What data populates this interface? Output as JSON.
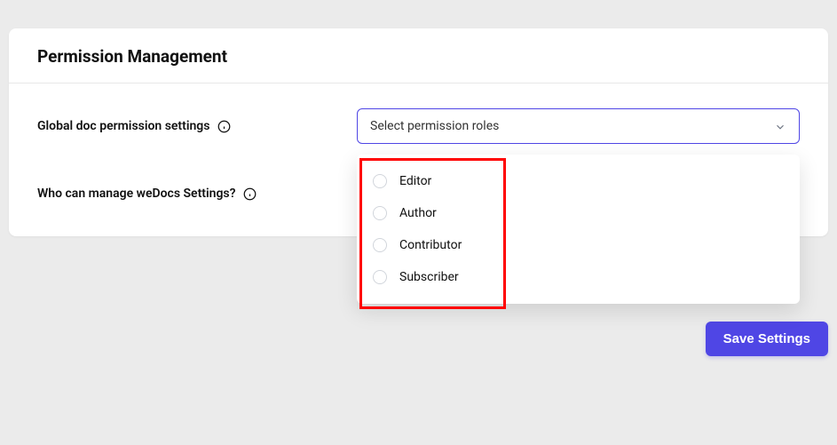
{
  "card": {
    "title": "Permission Management"
  },
  "form": {
    "global_permission": {
      "label": "Global doc permission settings",
      "select_placeholder": "Select permission roles",
      "options": [
        {
          "label": "Editor"
        },
        {
          "label": "Author"
        },
        {
          "label": "Contributor"
        },
        {
          "label": "Subscriber"
        }
      ]
    },
    "manage_settings": {
      "label": "Who can manage weDocs Settings?"
    }
  },
  "actions": {
    "save_label": "Save Settings"
  }
}
